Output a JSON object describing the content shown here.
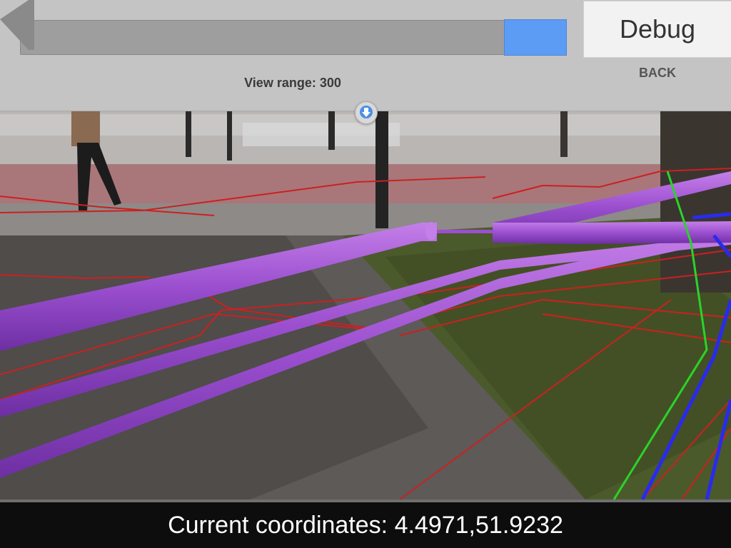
{
  "top_panel": {
    "view_range_label": "View range: 300",
    "slider_value": 300,
    "debug_label": "Debug",
    "back_label": "BACK",
    "back_arrow_icon": "back-arrow-icon",
    "collapse_icon": "arrow-down-circle-icon"
  },
  "status": {
    "coordinates_label": "Current coordinates: 4.4971,51.9232"
  },
  "colors": {
    "panel": "#c4c4c4",
    "slider_thumb": "#5d9cf5",
    "pipe_purple": "#9b4fcf",
    "line_red": "#cc2020",
    "line_green": "#2ad42a",
    "line_blue": "#2a2aee"
  }
}
